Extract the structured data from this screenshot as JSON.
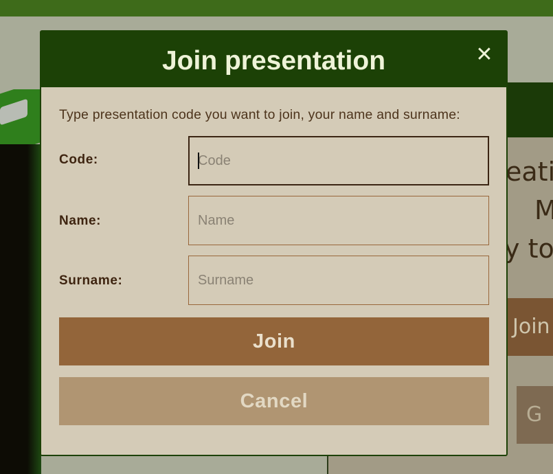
{
  "background": {
    "line1": "eatin",
    "line2": "M",
    "line3": "y to",
    "join_label": "Join",
    "go_label": "G"
  },
  "modal": {
    "title": "Join presentation",
    "close_glyph": "✕",
    "instructions": "Type presentation code you want to join, your name and surname:",
    "fields": {
      "code": {
        "label": "Code:",
        "placeholder": "Code",
        "value": ""
      },
      "name": {
        "label": "Name:",
        "placeholder": "Name",
        "value": ""
      },
      "surname": {
        "label": "Surname:",
        "placeholder": "Surname",
        "value": ""
      }
    },
    "join_label": "Join",
    "cancel_label": "Cancel"
  },
  "colors": {
    "header_green": "#1c4106",
    "join_brown": "#93653a",
    "cancel_tan": "#b09572",
    "modal_bg": "#d4cbb7"
  }
}
